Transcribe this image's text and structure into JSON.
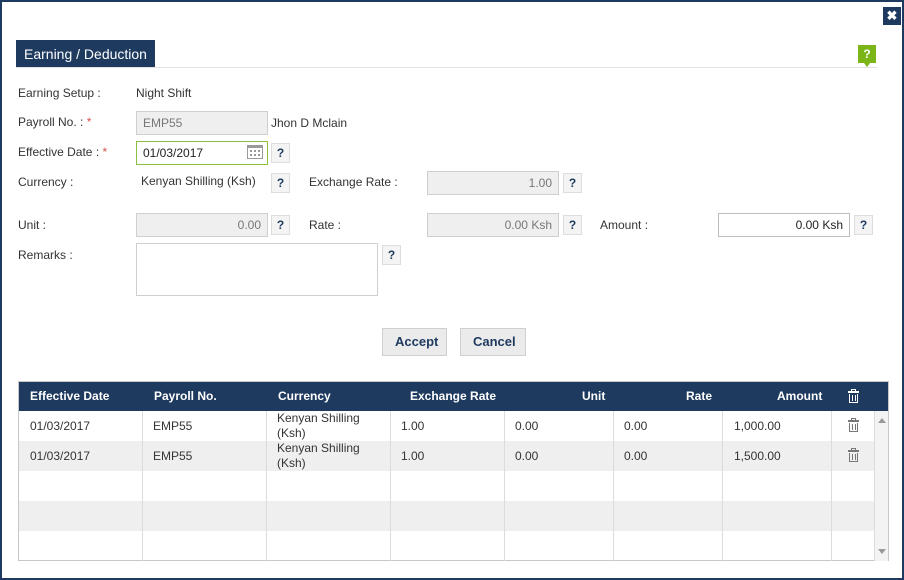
{
  "dialog": {
    "title": "Earning / Deduction",
    "close_icon": "✖",
    "help_label": "?"
  },
  "form": {
    "earning_setup_label": "Earning Setup :",
    "earning_setup_value": "Night Shift",
    "payroll_no_label": "Payroll No. :",
    "payroll_no_value": "EMP55",
    "employee_name": "Jhon D Mclain",
    "effective_date_label": "Effective Date :",
    "effective_date_value": "01/03/2017",
    "currency_label": "Currency :",
    "currency_value": "Kenyan Shilling (Ksh)",
    "exchange_rate_label": "Exchange Rate :",
    "exchange_rate_value": "1.00",
    "unit_label": "Unit :",
    "unit_value": "0.00",
    "rate_label": "Rate :",
    "rate_value": "0.00 Ksh",
    "amount_label": "Amount :",
    "amount_value": "0.00 Ksh",
    "remarks_label": "Remarks :",
    "remarks_value": "",
    "required_mark": "*",
    "help_label": "?"
  },
  "buttons": {
    "accept": "Accept",
    "cancel": "Cancel"
  },
  "grid": {
    "columns": [
      "Effective Date",
      "Payroll No.",
      "Currency",
      "Exchange Rate",
      "Unit",
      "Rate",
      "Amount"
    ],
    "rows": [
      [
        "01/03/2017",
        "EMP55",
        "Kenyan Shilling (Ksh)",
        "1.00",
        "0.00",
        "0.00",
        "1,000.00"
      ],
      [
        "01/03/2017",
        "EMP55",
        "Kenyan Shilling (Ksh)",
        "1.00",
        "0.00",
        "0.00",
        "1,500.00"
      ]
    ]
  },
  "colors": {
    "header_bg": "#1e3a5f",
    "help_green": "#7cb518",
    "required_red": "#d9534f"
  },
  "icons": {
    "close": "close-icon",
    "help": "help-icon",
    "calendar": "calendar-icon",
    "delete": "trash-icon"
  }
}
